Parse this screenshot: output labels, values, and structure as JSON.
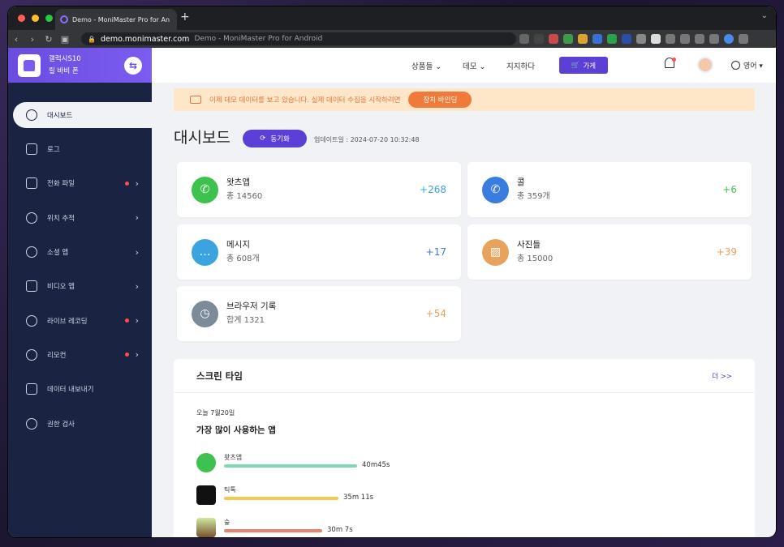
{
  "browser": {
    "tab_title": "Demo - MoniMaster Pro for An",
    "new_tab": "+",
    "url_domain": "demo.monimaster.com",
    "url_title": "Demo - MoniMaster Pro for Android"
  },
  "device": {
    "model": "갤럭시S10",
    "name": "릴 바비 폰"
  },
  "sidebar": {
    "items": [
      {
        "label": "대시보드"
      },
      {
        "label": "로그"
      },
      {
        "label": "전화 파일"
      },
      {
        "label": "위치 추적"
      },
      {
        "label": "소셜 앱"
      },
      {
        "label": "비디오 앱"
      },
      {
        "label": "라이브 레코딩"
      },
      {
        "label": "리모컨"
      },
      {
        "label": "데이터 내보내기"
      },
      {
        "label": "권한 검사"
      }
    ]
  },
  "topnav": {
    "products": "상품들 ⌄",
    "demo": "데모 ⌄",
    "support": "지지하다",
    "store": "가게",
    "language": "영어 ▾"
  },
  "banner": {
    "text": "이제 데모 데이터를 보고 있습니다. 실제 데이터 수집을 시작하려면",
    "button": "장치 바인딩"
  },
  "page": {
    "title": "대시보드",
    "sync_button": "동기화",
    "updated": "업데이트일 : 2024-07-20 10:32:48"
  },
  "cards": {
    "whatsapp": {
      "title": "왓츠앱",
      "sub": "총 14560",
      "count": "+268"
    },
    "calls": {
      "title": "콜",
      "sub": "총 359개",
      "count": "+6"
    },
    "messages": {
      "title": "메시지",
      "sub": "총 608개",
      "count": "+17"
    },
    "photos": {
      "title": "사진들",
      "sub": "총 15000",
      "count": "+39"
    },
    "browser": {
      "title": "브라우저 기록",
      "sub": "합계 1321",
      "count": "+54"
    }
  },
  "colors": {
    "accent": "#5b3fd6",
    "whatsapp": "#3ec24f",
    "calls": "#3a7de0",
    "messages": "#3aa3e0",
    "photos": "#e8a25c",
    "browser": "#7d8a99"
  },
  "screentime": {
    "title": "스크린 타임",
    "more": "더 >>",
    "date": "오늘 7월20일",
    "subtitle": "가장 많이 사용하는 앱",
    "apps": [
      {
        "name": "왓츠앱",
        "time": "40m45s",
        "fill": 1.0
      },
      {
        "name": "틱톡",
        "time": "35m 11s",
        "fill": 0.86
      },
      {
        "name": "숲",
        "time": "30m 7s",
        "fill": 0.74
      }
    ]
  }
}
